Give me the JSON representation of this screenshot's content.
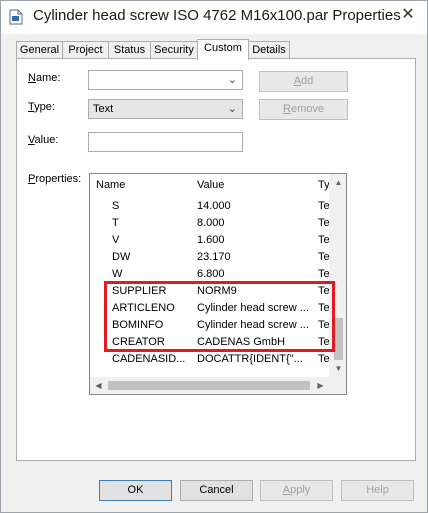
{
  "window": {
    "title": "Cylinder head screw ISO 4762 M16x100.par Properties",
    "close_glyph": "✕"
  },
  "tabs": [
    {
      "label": "General",
      "active": false
    },
    {
      "label": "Project",
      "active": false
    },
    {
      "label": "Status",
      "active": false
    },
    {
      "label": "Security",
      "active": false
    },
    {
      "label": "Custom",
      "active": true
    },
    {
      "label": "Details",
      "active": false
    }
  ],
  "form": {
    "name_label_u": "N",
    "name_label_rest": "ame:",
    "name_value": "",
    "type_label_u": "T",
    "type_label_rest": "ype:",
    "type_value": "Text",
    "value_label_u": "V",
    "value_label_rest": "alue:",
    "value_value": "",
    "properties_label_u": "P",
    "properties_label_rest": "roperties:",
    "add_label_u": "A",
    "add_label_rest": "dd",
    "remove_label_u": "R",
    "remove_label_rest": "emove"
  },
  "listview": {
    "columns": [
      "Name",
      "Value",
      "Ty"
    ],
    "rows": [
      {
        "name": "S",
        "value": "14.000",
        "type": "Te"
      },
      {
        "name": "T",
        "value": "8.000",
        "type": "Te"
      },
      {
        "name": "V",
        "value": "1.600",
        "type": "Te"
      },
      {
        "name": "DW",
        "value": "23.170",
        "type": "Te"
      },
      {
        "name": "W",
        "value": "6.800",
        "type": "Te"
      },
      {
        "name": "SUPPLIER",
        "value": "NORM9",
        "type": "Te"
      },
      {
        "name": "ARTICLENO",
        "value": "Cylinder head screw ...",
        "type": "Te"
      },
      {
        "name": "BOMINFO",
        "value": "Cylinder head screw ...",
        "type": "Te"
      },
      {
        "name": "CREATOR",
        "value": "CADENAS GmbH",
        "type": "Te"
      },
      {
        "name": "CADENASID...",
        "value": "DOCATTR{IDENT{\"...",
        "type": "Te"
      }
    ]
  },
  "buttons": {
    "ok": "OK",
    "cancel": "Cancel",
    "apply_u": "A",
    "apply_rest": "pply",
    "help": "Help"
  },
  "colors": {
    "highlight": "#e11b22",
    "default_button_border": "#3c7fb1"
  }
}
